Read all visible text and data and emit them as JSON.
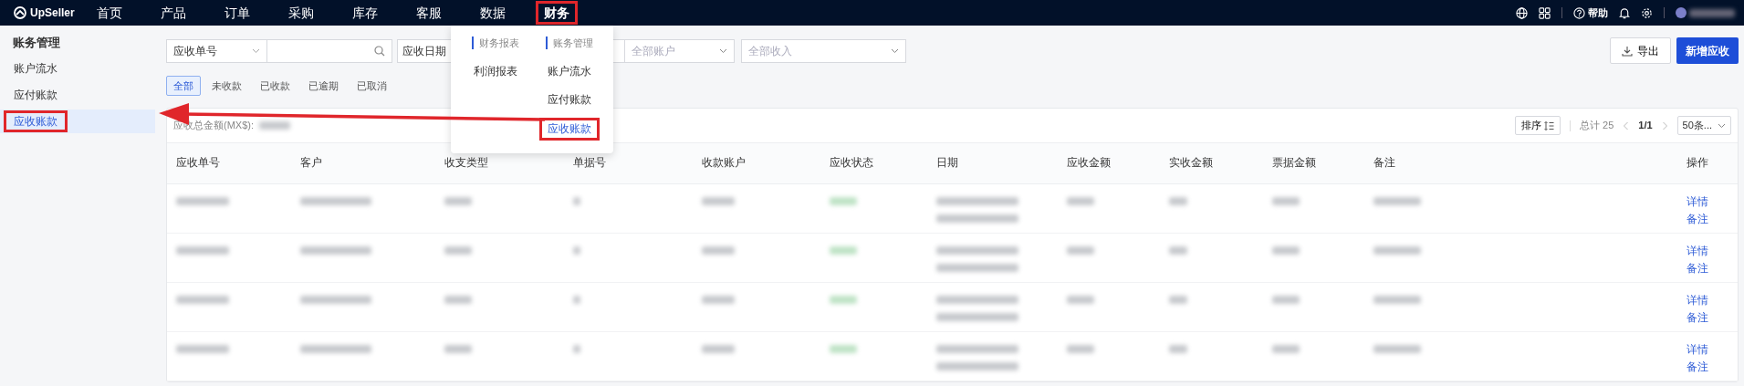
{
  "top_nav": {
    "logo": "UpSeller",
    "items": [
      {
        "label": "首页",
        "selected": false,
        "annotated": false
      },
      {
        "label": "产品",
        "selected": false,
        "annotated": false
      },
      {
        "label": "订单",
        "selected": false,
        "annotated": false
      },
      {
        "label": "采购",
        "selected": false,
        "annotated": false
      },
      {
        "label": "库存",
        "selected": false,
        "annotated": false
      },
      {
        "label": "客服",
        "selected": false,
        "annotated": false
      },
      {
        "label": "数据",
        "selected": false,
        "annotated": false
      },
      {
        "label": "财务",
        "selected": true,
        "annotated": true
      }
    ],
    "help": "帮助"
  },
  "nav_menu": {
    "groups": [
      {
        "title": "财务报表",
        "items": [
          {
            "label": "利润报表",
            "selected": false,
            "annotated": false
          }
        ]
      },
      {
        "title": "账务管理",
        "items": [
          {
            "label": "账户流水",
            "selected": false,
            "annotated": false
          },
          {
            "label": "应付账款",
            "selected": false,
            "annotated": false
          },
          {
            "label": "应收账款",
            "selected": true,
            "annotated": true
          }
        ]
      }
    ]
  },
  "sidebar": {
    "title": "账务管理",
    "items": [
      {
        "label": "账户流水",
        "selected": false,
        "annotated": false
      },
      {
        "label": "应付账款",
        "selected": false,
        "annotated": false
      },
      {
        "label": "应收账款",
        "selected": true,
        "annotated": true
      }
    ]
  },
  "annotation_arrow": true,
  "filters": {
    "search_type": "应收单号",
    "date": "应收日期",
    "account": {
      "placeholder": "全部账户"
    },
    "income": {
      "placeholder": "全部收入"
    }
  },
  "export_button": "导出",
  "add_button": "新增应收",
  "status_tabs": [
    {
      "label": "全部",
      "selected": true
    },
    {
      "label": "未收款",
      "selected": false
    },
    {
      "label": "已收款",
      "selected": false
    },
    {
      "label": "已逾期",
      "selected": false
    },
    {
      "label": "已取消",
      "selected": false
    }
  ],
  "summary_label": "应收总金额(MX$):",
  "toolbar": {
    "sort": "排序",
    "total": "总计 25",
    "page": "1/1",
    "page_size": "50条..."
  },
  "table": {
    "columns": [
      "应收单号",
      "客户",
      "收支类型",
      "单据号",
      "收款账户",
      "应收状态",
      "日期",
      "应收金额",
      "实收金额",
      "票据金额",
      "备注",
      "操作"
    ],
    "rows": [
      {
        "actions": [
          "详情",
          "备注"
        ]
      },
      {
        "actions": [
          "详情",
          "备注"
        ]
      },
      {
        "actions": [
          "详情",
          "备注"
        ]
      },
      {
        "actions": [
          "详情",
          "备注"
        ]
      }
    ]
  }
}
